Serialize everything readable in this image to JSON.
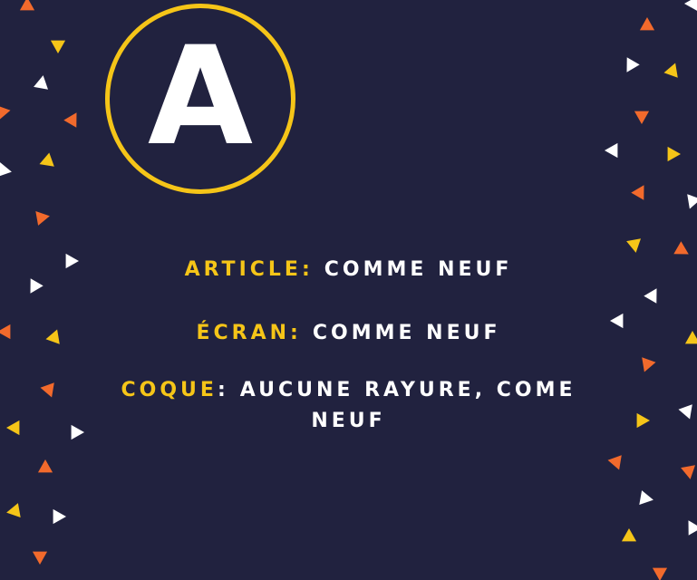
{
  "badge": {
    "letter": "A",
    "ring_color": "#f5c518",
    "letter_color": "#ffffff"
  },
  "colors": {
    "background": "#21223f",
    "label": "#f5c518",
    "value": "#ffffff",
    "confetti": [
      "#f26a2c",
      "#f5c518",
      "#ffffff"
    ]
  },
  "conditions": [
    {
      "label": "ARTICLE:",
      "value": "COMME NEUF"
    },
    {
      "label": "ÉCRAN:",
      "value": "COMME NEUF"
    },
    {
      "label": "COQUE",
      "separator": ":",
      "value": "AUCUNE RAYURE, COME",
      "value_continued": "NEUF"
    }
  ]
}
